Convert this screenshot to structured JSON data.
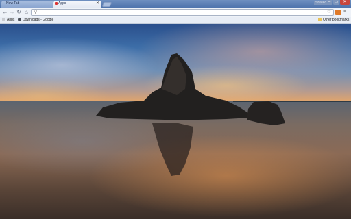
{
  "window": {
    "user_label": "Shared",
    "min_glyph": "–",
    "max_glyph": "▭",
    "close_glyph": "✕"
  },
  "tabs": [
    {
      "label": "New Tab",
      "close": "✕"
    },
    {
      "label": "Apps",
      "close": "✕"
    }
  ],
  "toolbar": {
    "back_glyph": "←",
    "forward_glyph": "→",
    "reload_glyph": "↻",
    "home_glyph": "⌂",
    "omnibox_value": "",
    "search_glyph": "⚲",
    "star_glyph": "☆",
    "menu_glyph": "≡"
  },
  "bookmarks": {
    "apps": "Apps",
    "downloads": "Downloads - Google",
    "other": "Other bookmarks"
  },
  "colors": {
    "titlebar": "#4f74ad",
    "close_button": "#c9463d",
    "extension": "#e07b2a"
  }
}
